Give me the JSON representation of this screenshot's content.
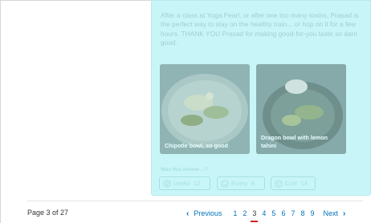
{
  "review": {
    "text": "After a class at Yoga Pearl, or after one too many toxins, Prasad is the perfect way to stay on the healthy train... or hop on it for a few hours. THANK YOU Prasad for making good-for-you taste so darn good.",
    "photos": [
      {
        "caption": "Chipotle bowl, so good"
      },
      {
        "caption": "Dragon bowl with lemon tahini"
      }
    ],
    "helpful_prompt": "Was this review ...?",
    "votes": [
      {
        "label": "Useful",
        "count": "12",
        "icon": "lightbulb-icon"
      },
      {
        "label": "Funny",
        "count": "8",
        "icon": "smile-icon"
      },
      {
        "label": "Cool",
        "count": "14",
        "icon": "cool-face-icon"
      }
    ]
  },
  "pagination": {
    "page_info": "Page 3 of 27",
    "previous_label": "Previous",
    "next_label": "Next",
    "pages": [
      "1",
      "2",
      "3",
      "4",
      "5",
      "6",
      "7",
      "8",
      "9"
    ],
    "current_page": "3"
  },
  "colors": {
    "highlight_bg": "#c8f6f8",
    "link": "#0073bb",
    "current_underline": "#d32323"
  }
}
